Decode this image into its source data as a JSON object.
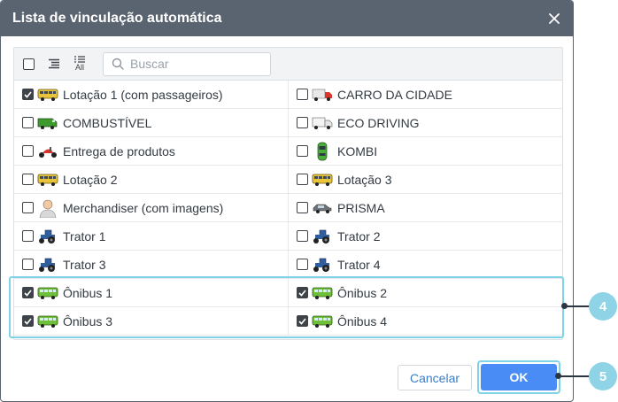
{
  "dialog": {
    "title": "Lista de vinculação automática"
  },
  "toolbar": {
    "search_placeholder": "Buscar",
    "all_label": "All"
  },
  "units": [
    {
      "label": "Lotação 1 (com passageiros)",
      "checked": true,
      "icon": "bus-yellow-icon"
    },
    {
      "label": "CARRO DA CIDADE",
      "checked": false,
      "icon": "truck-red-icon"
    },
    {
      "label": "COMBUSTÍVEL",
      "checked": false,
      "icon": "van-green-icon"
    },
    {
      "label": "ECO DRIVING",
      "checked": false,
      "icon": "truck-white-icon"
    },
    {
      "label": "Entrega de produtos",
      "checked": false,
      "icon": "scooter-red-icon"
    },
    {
      "label": "KOMBI",
      "checked": false,
      "icon": "car-green-topview-icon"
    },
    {
      "label": "Lotação 2",
      "checked": false,
      "icon": "bus-yellow-icon"
    },
    {
      "label": "Lotação 3",
      "checked": false,
      "icon": "bus-yellow-icon"
    },
    {
      "label": "Merchandiser (com imagens)",
      "checked": false,
      "icon": "person-icon"
    },
    {
      "label": "PRISMA",
      "checked": false,
      "icon": "car-gray-icon"
    },
    {
      "label": "Trator 1",
      "checked": false,
      "icon": "tractor-blue-icon"
    },
    {
      "label": "Trator 2",
      "checked": false,
      "icon": "tractor-blue-icon"
    },
    {
      "label": "Trator 3",
      "checked": false,
      "icon": "tractor-blue-icon"
    },
    {
      "label": "Trator 4",
      "checked": false,
      "icon": "tractor-blue-icon"
    },
    {
      "label": "Ônibus 1",
      "checked": true,
      "icon": "bus-green-icon"
    },
    {
      "label": "Ônibus 2",
      "checked": true,
      "icon": "bus-green-icon"
    },
    {
      "label": "Ônibus 3",
      "checked": true,
      "icon": "bus-green-icon"
    },
    {
      "label": "Ônibus 4",
      "checked": true,
      "icon": "bus-green-icon"
    }
  ],
  "buttons": {
    "cancel": "Cancelar",
    "ok": "OK"
  },
  "callouts": {
    "rows": "4",
    "ok": "5"
  },
  "colors": {
    "titlebar": "#5a6370",
    "primary": "#4a8cf5",
    "highlight": "#7fd3e6",
    "callout": "#8fd4e6"
  }
}
